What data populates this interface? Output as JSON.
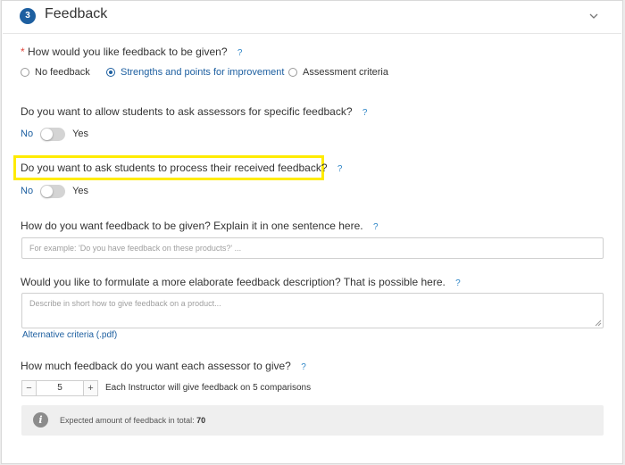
{
  "section": {
    "step_number": "3",
    "title": "Feedback",
    "collapse_icon": "chevron-down-icon"
  },
  "help_marker": "?",
  "feedback_type": {
    "question": "How would you like feedback to be given?",
    "required_marker": "*",
    "options": [
      {
        "label": "No feedback",
        "selected": false
      },
      {
        "label": "Strengths and points for improvement",
        "selected": true
      },
      {
        "label": "Assessment criteria",
        "selected": false
      }
    ]
  },
  "ask_assessors": {
    "question": "Do you want to allow students to ask assessors for specific feedback?",
    "no_label": "No",
    "yes_label": "Yes",
    "value": "No"
  },
  "process_feedback": {
    "question": "Do you want to ask students to process their received feedback?",
    "no_label": "No",
    "yes_label": "Yes",
    "value": "No"
  },
  "one_sentence": {
    "question": "How do you want feedback to be given? Explain it in one sentence here.",
    "placeholder": "For example: 'Do you have feedback on these products?' ..."
  },
  "elaborate": {
    "question": "Would you like to formulate a more elaborate feedback description? That is possible here.",
    "placeholder": "Describe in short how to give feedback on a product...",
    "link_text": "Alternative criteria (.pdf)"
  },
  "amount": {
    "question": "How much feedback do you want each assessor to give?",
    "minus": "−",
    "value": "5",
    "plus": "+",
    "note": "Each Instructor will give feedback on 5 comparisons"
  },
  "info": {
    "icon": "info-icon",
    "glyph": "i",
    "text": "Expected amount of feedback in total:",
    "total": "70"
  },
  "colors": {
    "accent": "#1d5fa0",
    "help": "#2f86c7",
    "required": "#e0453a",
    "highlight": "#ffeb00"
  }
}
